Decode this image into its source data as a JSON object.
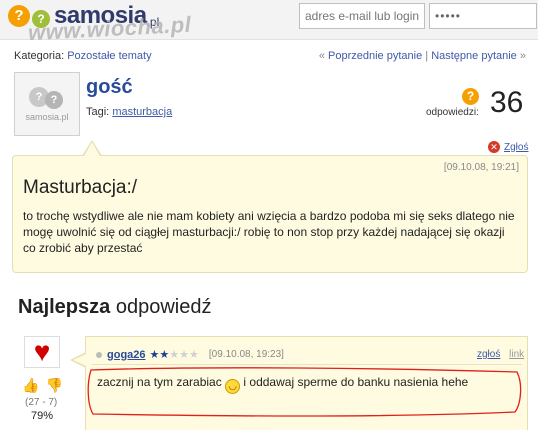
{
  "site": {
    "logo_text": "samosia",
    "logo_suffix": ".pl",
    "logo_q1": "?",
    "logo_q2": "?",
    "watermark": "www.wiocha.pl"
  },
  "login": {
    "email_placeholder": "adres e-mail lub login",
    "password_value": "•••••"
  },
  "category": {
    "label": "Kategoria:",
    "value": "Pozostałe tematy",
    "prev_prefix": "«",
    "prev": "Poprzednie pytanie",
    "sep": "|",
    "next": "Następne pytanie",
    "next_suffix": "»"
  },
  "question": {
    "author": "gość",
    "tags_label": "Tagi:",
    "tag": "masturbacja",
    "avatar_text": "samosia.pl",
    "answers_label": "odpowiedzi:",
    "answers_count": "36",
    "report": "Zgłoś",
    "date": "[09.10.08, 19:21]",
    "title": "Masturbacja:/",
    "body": "to trochę wstydliwe ale nie mam kobiety ani wzięcia a bardzo podoba mi się seks dlatego nie mogę uwolnić się od ciągłej masturbacji:/ robię to non stop przy każdej nadającej się okazji co zrobić aby przestać"
  },
  "best_answer": {
    "heading_bold": "Najlepsza",
    "heading_rest": "odpowiedź",
    "votes": "(27 - 7)",
    "percent": "79%",
    "user": "goga26",
    "rating_stars": 1.5,
    "rating_max": 5,
    "date": "[09.10.08, 19:23]",
    "report_link": "zgłoś",
    "link_link": "link",
    "body_part1": "zacznij na tym zarabiac",
    "body_part2": "i oddawaj sperme do banku nasienia hehe"
  },
  "colors": {
    "accent_blue": "#2a4a9a",
    "link_blue": "#3f5aa8",
    "question_bg": "#fffbe0",
    "orange": "#f5a000",
    "red_annotation": "#e0201c"
  },
  "icons": [
    "question-logo-icon",
    "answers-question-icon",
    "report-x-icon",
    "heart-icon",
    "thumb-up-icon",
    "thumb-down-icon",
    "star-icon",
    "smiley-icon"
  ]
}
